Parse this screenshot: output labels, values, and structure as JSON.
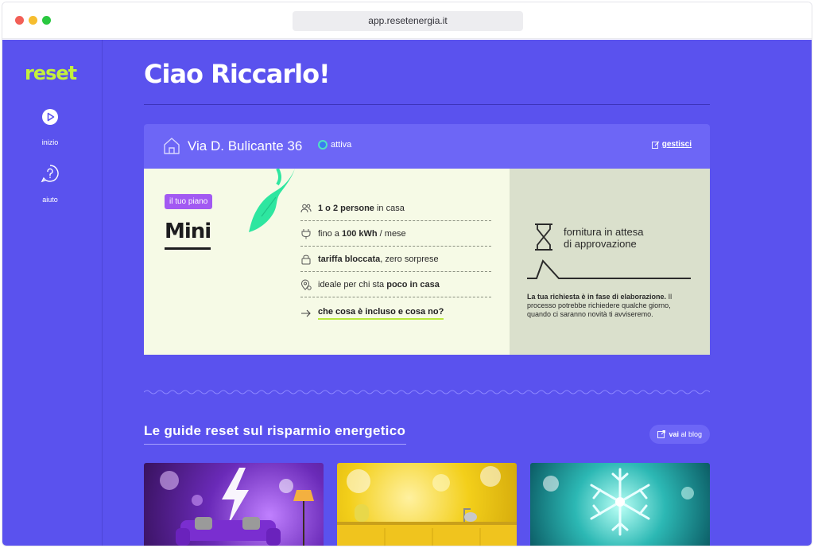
{
  "browser": {
    "url": "app.resetenergia.it"
  },
  "sidebar": {
    "logo": "reset",
    "items": [
      {
        "label": "inizio",
        "icon": "play-icon"
      },
      {
        "label": "aiuto",
        "icon": "help-icon"
      }
    ]
  },
  "header": {
    "greeting": "Ciao Riccarlo!"
  },
  "supply": {
    "address": "Via D. Bulicante 36",
    "status": "attiva",
    "manage_label": "gestisci",
    "plan_badge": "il tuo piano",
    "plan_name": "Mini",
    "features": [
      {
        "icon": "people-icon",
        "bold": "1 o 2 persone",
        "text": " in casa"
      },
      {
        "icon": "plug-icon",
        "prefix": "fino a ",
        "bold": "100 kWh",
        "text": " / mese"
      },
      {
        "icon": "lock-icon",
        "bold": "tariffa bloccata",
        "text": ", zero sorprese"
      },
      {
        "icon": "location-icon",
        "prefix": "ideale per chi sta ",
        "bold": "poco in casa",
        "text": ""
      }
    ],
    "more_link": "che cosa è incluso e cosa no?",
    "pending": {
      "title_line1": "fornitura in attesa",
      "title_line2": "di approvazione",
      "text_bold": "La tua richiesta è in fase di elaborazione.",
      "text": " Il processo potrebbe richiedere qualche giorno, quando ci saranno novità ti avviseremo."
    }
  },
  "guides": {
    "title": "Le guide reset sul risparmio energetico",
    "blog_bold": "vai",
    "blog_text": " al blog"
  },
  "colors": {
    "background": "#5a52ee",
    "accent": "#c4f03c",
    "badge": "#a259f2",
    "card": "#f6fae6",
    "pending": "#dae0cc"
  }
}
